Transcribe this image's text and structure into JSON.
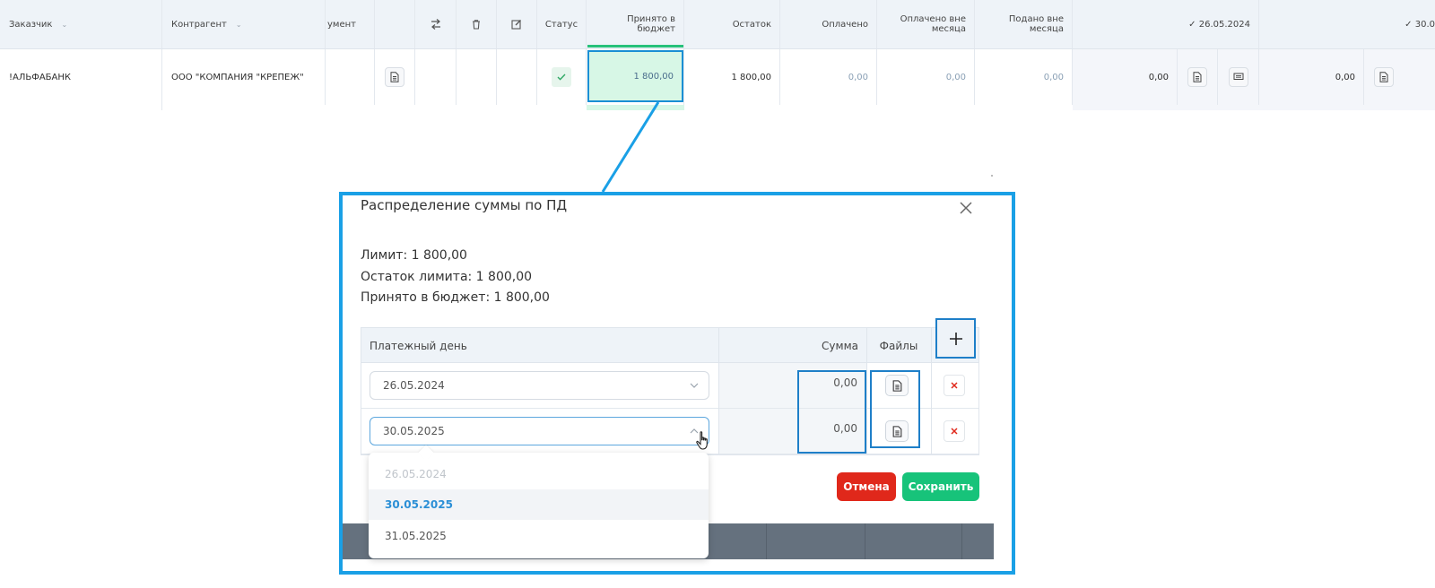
{
  "table": {
    "headers": {
      "customer": "Заказчик",
      "counterparty": "Контрагент",
      "document": "умент",
      "status": "Статус",
      "accepted_budget": "Принято в бюджет",
      "remainder": "Остаток",
      "paid": "Оплачено",
      "paid_outside_month": "Оплачено вне месяца",
      "submitted_outside_month": "Подано вне месяца",
      "date_col_1": "✓ 26.05.2024",
      "date_col_2": "✓ 30.0"
    },
    "row": {
      "customer": "!АЛЬФАБАНК",
      "counterparty": "ООО \"КОМПАНИЯ \"КРЕПЕЖ\"",
      "accepted_budget": "1 800,00",
      "remainder": "1 800,00",
      "paid": "0,00",
      "paid_outside_month": "0,00",
      "submitted_outside_month": "0,00",
      "date1_value": "0,00",
      "date2_value": "0,00"
    }
  },
  "dialog": {
    "title": "Распределение суммы по ПД",
    "limit": "Лимит: 1 800,00",
    "limit_remainder": "Остаток лимита: 1 800,00",
    "accepted_budget": "Принято в бюджет: 1 800,00",
    "columns": {
      "payment_day": "Платежный день",
      "sum": "Сумма",
      "files": "Файлы"
    },
    "rows": [
      {
        "date": "26.05.2024",
        "sum": "0,00"
      },
      {
        "date": "30.05.2025",
        "sum": "0,00"
      }
    ],
    "dropdown_options": [
      "26.05.2024",
      "30.05.2025",
      "31.05.2025"
    ],
    "cancel_label": "Отмена",
    "save_label": "Сохранить"
  },
  "colors": {
    "highlight_border": "#1aa0e6",
    "budget_cell_bg": "#d7f7e6",
    "cancel_button": "#e0281b",
    "save_button": "#17c37a",
    "selected_option": "#2b8fd6"
  }
}
